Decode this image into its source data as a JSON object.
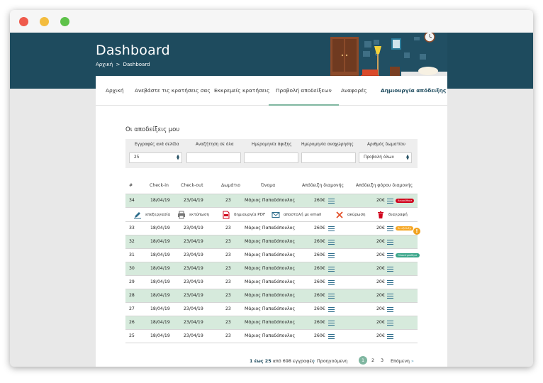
{
  "header": {
    "title": "Dashboard",
    "breadcrumb": [
      "Αρχική",
      ">",
      "Dashboard"
    ]
  },
  "tabs": [
    {
      "label": "Αρχική"
    },
    {
      "label": "Ανεβάστε τις κρατήσεις σας"
    },
    {
      "label": "Εκκρεμείς κρατήσεις"
    },
    {
      "label": "Προβολή αποδείξεων"
    },
    {
      "label": "Αναφορές"
    },
    {
      "label": "Δημιουργία απόδειξης"
    }
  ],
  "section_title": "Οι αποδείξεις μου",
  "filters": {
    "per_page_label": "Εγγραφές ανά σελίδα",
    "per_page_value": "25",
    "search_label": "Αναζήτηση σε όλα",
    "search_value": "",
    "arrival_label": "Ημερομηνία άφιξης",
    "arrival_value": "",
    "departure_label": "Ημερομηνία αναχώρησης",
    "departure_value": "",
    "room_label": "Αριθμός δωματίου",
    "room_value": "Προβολή όλων"
  },
  "table": {
    "headers": [
      "#",
      "Check-in",
      "Check-out",
      "Δωμάτιο",
      "Όνομα",
      "Απόδειξη διαμονής",
      "Απόδειξη φόρου διαμονής"
    ],
    "rows": [
      {
        "id": "34",
        "checkin": "18/04/19",
        "checkout": "23/04/19",
        "room": "23",
        "name": "Μάριος Παπαδόπουλος",
        "stay": "260€",
        "tax": "20€",
        "badge": "Ακυρώθηκε"
      },
      {
        "id": "33",
        "checkin": "18/04/19",
        "checkout": "23/04/19",
        "room": "23",
        "name": "Μάριος Παπαδόπουλος",
        "stay": "260€",
        "tax": "20€",
        "badge": "Σε εξέλιξη"
      },
      {
        "id": "32",
        "checkin": "18/04/19",
        "checkout": "23/04/19",
        "room": "23",
        "name": "Μάριος Παπαδόπουλος",
        "stay": "260€",
        "tax": "20€",
        "badge": ""
      },
      {
        "id": "31",
        "checkin": "18/04/19",
        "checkout": "23/04/19",
        "room": "23",
        "name": "Μάριος Παπαδόπουλος",
        "stay": "260€",
        "tax": "20€",
        "badge": "Ολοκληρώθηκε"
      },
      {
        "id": "30",
        "checkin": "18/04/19",
        "checkout": "23/04/19",
        "room": "23",
        "name": "Μάριος Παπαδόπουλος",
        "stay": "260€",
        "tax": "20€",
        "badge": ""
      },
      {
        "id": "29",
        "checkin": "18/04/19",
        "checkout": "23/04/19",
        "room": "23",
        "name": "Μάριος Παπαδόπουλος",
        "stay": "260€",
        "tax": "20€",
        "badge": ""
      },
      {
        "id": "28",
        "checkin": "18/04/19",
        "checkout": "23/04/19",
        "room": "23",
        "name": "Μάριος Παπαδόπουλος",
        "stay": "260€",
        "tax": "20€",
        "badge": ""
      },
      {
        "id": "27",
        "checkin": "18/04/19",
        "checkout": "23/04/19",
        "room": "23",
        "name": "Μάριος Παπαδόπουλος",
        "stay": "260€",
        "tax": "20€",
        "badge": ""
      },
      {
        "id": "26",
        "checkin": "18/04/19",
        "checkout": "23/04/19",
        "room": "23",
        "name": "Μάριος Παπαδόπουλος",
        "stay": "260€",
        "tax": "20€",
        "badge": ""
      },
      {
        "id": "25",
        "checkin": "18/04/19",
        "checkout": "23/04/19",
        "room": "23",
        "name": "Μάριος Παπαδόπουλος",
        "stay": "260€",
        "tax": "20€",
        "badge": ""
      }
    ],
    "actions": [
      {
        "label": "επεξεργασία",
        "icon": "pencil-icon"
      },
      {
        "label": "εκτύπωση",
        "icon": "printer-icon"
      },
      {
        "label": "δημιουργία PDF",
        "icon": "pdf-icon"
      },
      {
        "label": "αποστολή με email",
        "icon": "envelope-icon"
      },
      {
        "label": "ακύρωση",
        "icon": "x-icon"
      },
      {
        "label": "διαγραφή",
        "icon": "trash-icon"
      }
    ]
  },
  "pagination": {
    "range": "1 έως 25",
    "total_text": "από 698 εγγραφές",
    "prev_label": "Προηγούμενη",
    "pages": [
      "1",
      "2",
      "3"
    ],
    "current_page": "1",
    "next_label": "Επόμενη"
  },
  "colors": {
    "header_bg": "#1e4b5e",
    "row_alt": "#d6eadc",
    "accent": "#7fb6a0",
    "badge_cancelled": "#d0021b",
    "badge_progress": "#f5a623",
    "badge_done": "#3aa68a"
  }
}
